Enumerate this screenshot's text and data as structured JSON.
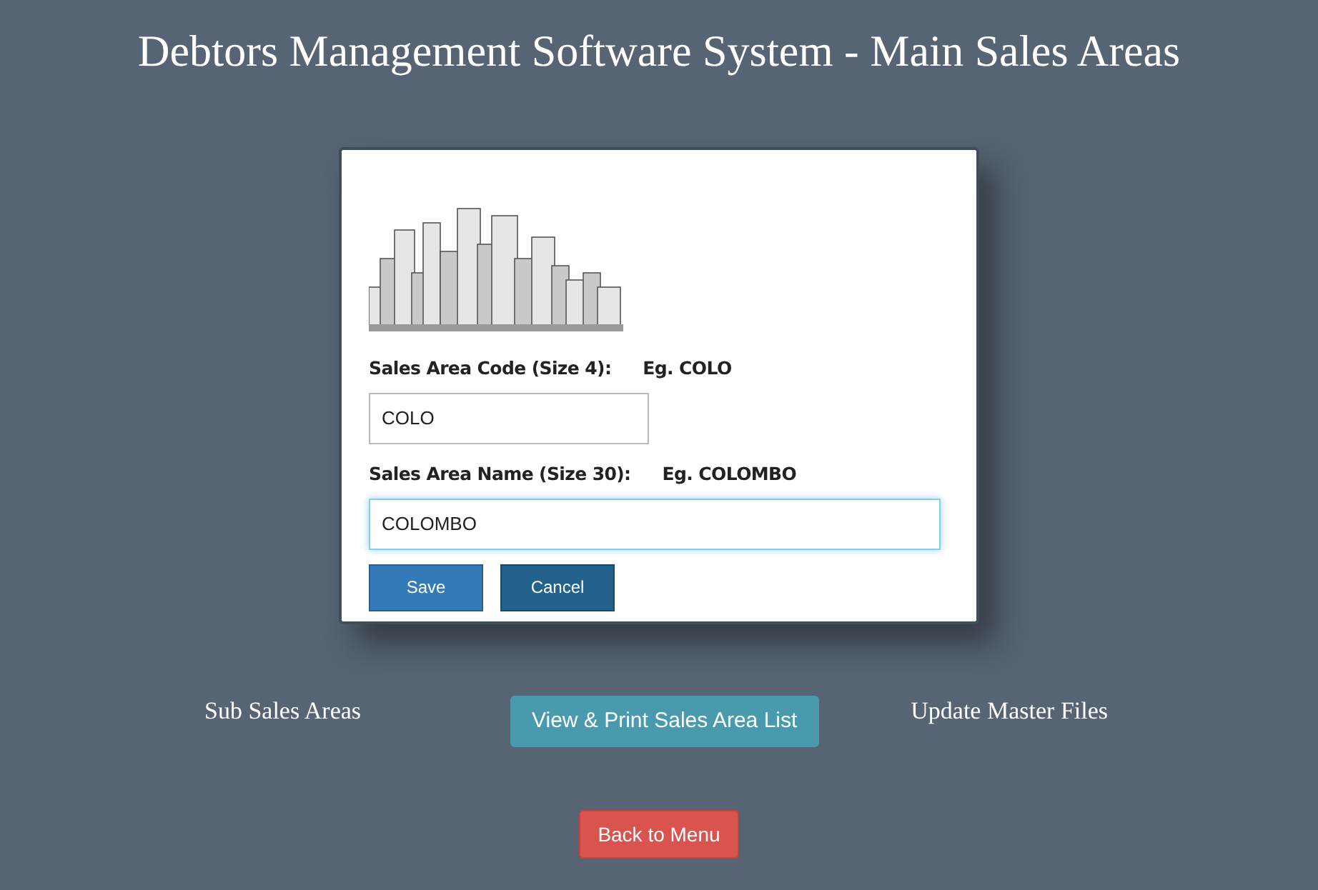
{
  "title": "Debtors Management Software System - Main Sales Areas",
  "form": {
    "fields": [
      {
        "label": "Sales Area Code (Size 4):",
        "hint": "Eg. COLO",
        "value": "COLO",
        "focused": false,
        "wide": false
      },
      {
        "label": "Sales Area Name (Size 30):",
        "hint": "Eg. COLOMBO",
        "value": "COLOMBO",
        "focused": true,
        "wide": true
      }
    ],
    "buttons": [
      "Save",
      "Cancel"
    ]
  },
  "links": {
    "left": "Sub Sales Areas",
    "center": "View & Print Sales Area List",
    "right": "Update Master Files"
  },
  "back_button": "Back to Menu"
}
